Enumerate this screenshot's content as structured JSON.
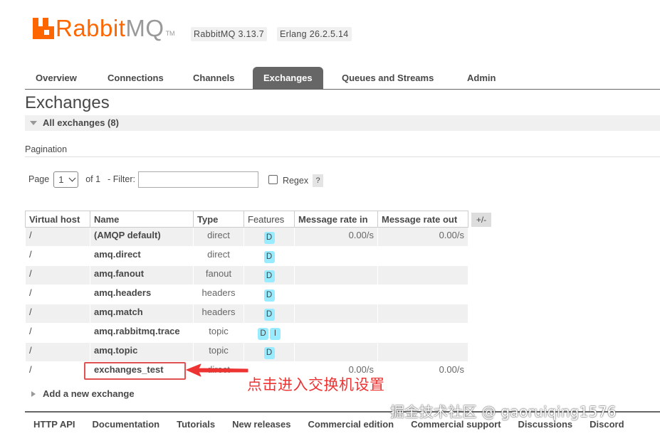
{
  "header": {
    "logo_rabbit": "Rabbit",
    "logo_mq": "MQ",
    "logo_tm": "TM",
    "rabbitmq_version": "RabbitMQ 3.13.7",
    "erlang_version": "Erlang 26.2.5.14"
  },
  "nav": {
    "tabs": [
      {
        "label": "Overview"
      },
      {
        "label": "Connections"
      },
      {
        "label": "Channels"
      },
      {
        "label": "Exchanges",
        "active": true
      },
      {
        "label": "Queues and Streams"
      },
      {
        "label": "Admin"
      }
    ]
  },
  "page": {
    "title": "Exchanges",
    "section_title": "All exchanges (8)"
  },
  "pagination": {
    "label": "Pagination",
    "page_label": "Page",
    "page_value": "1",
    "of_label": "of 1",
    "filter_label": "- Filter:",
    "filter_value": "",
    "regex_label": "Regex",
    "regex_checked": false,
    "help": "?"
  },
  "table": {
    "columns": [
      "Virtual host",
      "Name",
      "Type",
      "Features",
      "Message rate in",
      "Message rate out"
    ],
    "toggle_columns": "+/-",
    "rows": [
      {
        "vhost": "/",
        "name": "(AMQP default)",
        "type": "direct",
        "features": [
          "D"
        ],
        "rate_in": "0.00/s",
        "rate_out": "0.00/s"
      },
      {
        "vhost": "/",
        "name": "amq.direct",
        "type": "direct",
        "features": [
          "D"
        ],
        "rate_in": "",
        "rate_out": ""
      },
      {
        "vhost": "/",
        "name": "amq.fanout",
        "type": "fanout",
        "features": [
          "D"
        ],
        "rate_in": "",
        "rate_out": ""
      },
      {
        "vhost": "/",
        "name": "amq.headers",
        "type": "headers",
        "features": [
          "D"
        ],
        "rate_in": "",
        "rate_out": ""
      },
      {
        "vhost": "/",
        "name": "amq.match",
        "type": "headers",
        "features": [
          "D"
        ],
        "rate_in": "",
        "rate_out": ""
      },
      {
        "vhost": "/",
        "name": "amq.rabbitmq.trace",
        "type": "topic",
        "features": [
          "D",
          "I"
        ],
        "rate_in": "",
        "rate_out": ""
      },
      {
        "vhost": "/",
        "name": "amq.topic",
        "type": "topic",
        "features": [
          "D"
        ],
        "rate_in": "",
        "rate_out": ""
      },
      {
        "vhost": "/",
        "name": "exchanges_test",
        "type": "direct",
        "features": [],
        "rate_in": "0.00/s",
        "rate_out": "0.00/s"
      }
    ]
  },
  "annotation": {
    "text": "点击进入交换机设置",
    "color": "#ee3333"
  },
  "add_exchange": {
    "label": "Add a new exchange"
  },
  "footer": {
    "links": [
      "HTTP API",
      "Documentation",
      "Tutorials",
      "New releases",
      "Commercial edition",
      "Commercial support",
      "Discussions",
      "Discord"
    ]
  },
  "watermark": {
    "text": "掘金技术社区 @ gaoruiqing1576"
  },
  "colors": {
    "brand_orange": "#ff6600",
    "nav_active": "#666666",
    "feature_badge": "#99ebff",
    "row_alt": "#f0f0f0"
  }
}
